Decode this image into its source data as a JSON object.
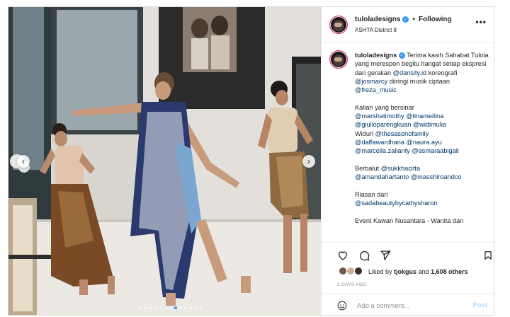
{
  "post": {
    "username": "tuloladesigns",
    "follow_status": "Following",
    "location": "ASHTA District 8",
    "more_label": "•••"
  },
  "caption": {
    "username": "tuloladesigns",
    "line1": "Terima kasih Sahabat Tulola yang merespon begitu hangat setiap ekspresi dari gerakan",
    "m_dansity": "@dansity.id",
    "t_koreografi": " koreografi ",
    "m_josmarcy": "@josmarcy",
    "t_diiringi": "diiringi musik ciptaan ",
    "m_freza": "@freza_music",
    "p2_intro": "Kalian yang bersinar",
    "m_marshatimothy": "@marshatimothy",
    "m_tinameilina": "@tinameilina",
    "m_giulioparengkuan": "@giulioparengkuan",
    "m_widimulia": "@widimulia",
    "t_widuri": "Widuri ",
    "m_thesasonofamily": "@thesasonofamily",
    "m_daffawardhana": "@daffawardhana",
    "m_nauraayu": "@naura.ayu",
    "m_marcellazalianty": "@marcella.zalianty",
    "m_asmaraabigail": "@asmaraabigail",
    "p3_intro": "Berbalut ",
    "m_sukkhacitta": "@sukkhacitta",
    "m_amandahartanto": "@amandahartanto",
    "m_masshiroandco": "@masshiroandco",
    "p4_intro": "Riasan dari",
    "m_sadabeauty": "@sadabeautybycathysharon",
    "p5_partial": "Event Kawan Nusantara - Wanita dan"
  },
  "engagement": {
    "liked_by_prefix": "Liked by ",
    "liked_by_user": "tjokgus",
    "and_text": " and ",
    "likes_count": "1,608 others",
    "date": "2 DAYS AGO"
  },
  "comment": {
    "placeholder": "Add a comment...",
    "post_label": "Post"
  },
  "carousel": {
    "slide_count": 13,
    "active_index": 7,
    "prev_icon": "chevron-left-icon",
    "next_icon": "chevron-right-icon"
  },
  "colors": {
    "mention": "#00376b",
    "post_button_disabled": "#b3dbff",
    "verified": "#3897f0",
    "active_dot": "#3797f0"
  }
}
